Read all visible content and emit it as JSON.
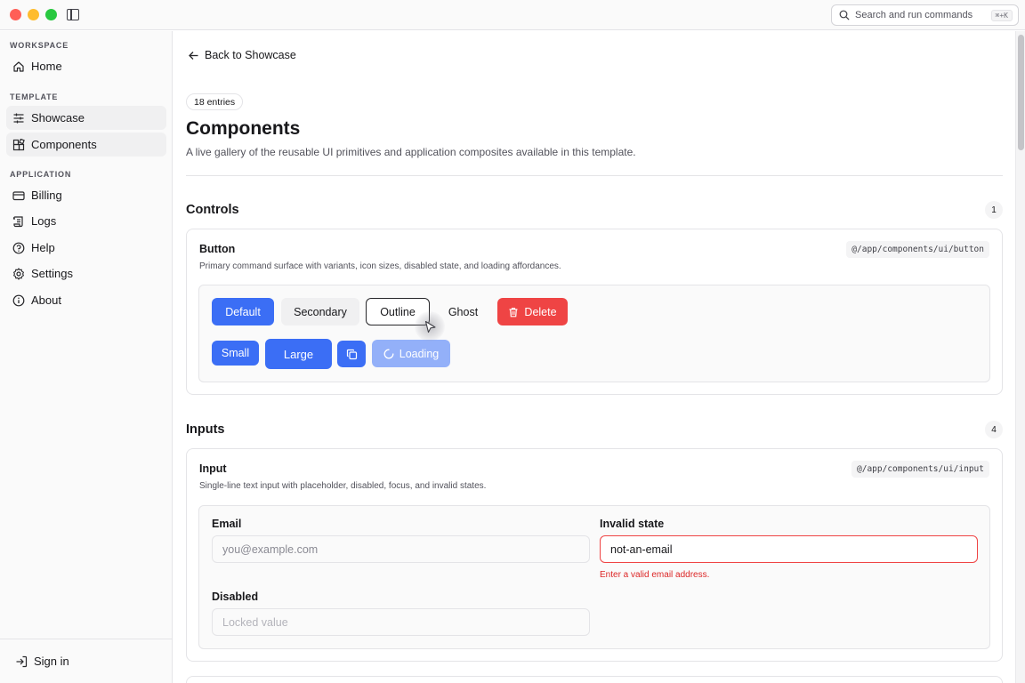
{
  "window": {
    "search": {
      "placeholder": "Search and run commands",
      "shortcut": "⌘+K"
    }
  },
  "sidebar": {
    "groups": [
      {
        "label": "WORKSPACE",
        "items": [
          {
            "label": "Home",
            "icon": "home-icon"
          }
        ]
      },
      {
        "label": "TEMPLATE",
        "items": [
          {
            "label": "Showcase",
            "icon": "sliders-icon"
          },
          {
            "label": "Components",
            "icon": "components-icon"
          }
        ]
      },
      {
        "label": "APPLICATION",
        "items": [
          {
            "label": "Billing",
            "icon": "credit-card-icon"
          },
          {
            "label": "Logs",
            "icon": "scroll-icon"
          },
          {
            "label": "Help",
            "icon": "help-circle-icon"
          },
          {
            "label": "Settings",
            "icon": "gear-icon"
          },
          {
            "label": "About",
            "icon": "info-icon"
          }
        ]
      }
    ],
    "footer": {
      "label": "Sign in",
      "icon": "sign-in-icon"
    }
  },
  "header": {
    "back_label": "Back to Showcase",
    "badge": "18 entries",
    "title": "Components",
    "description": "A live gallery of the reusable UI primitives and application composites available in this template."
  },
  "sections": {
    "controls": {
      "title": "Controls",
      "count": "1",
      "card": {
        "title": "Button",
        "description": "Primary command surface with variants, icon sizes, disabled state, and loading affordances.",
        "path": "@/app/components/ui/button",
        "buttons": {
          "default": "Default",
          "secondary": "Secondary",
          "outline": "Outline",
          "ghost": "Ghost",
          "delete": "Delete",
          "small": "Small",
          "large": "Large",
          "loading": "Loading"
        }
      }
    },
    "inputs": {
      "title": "Inputs",
      "count": "4",
      "card": {
        "title": "Input",
        "description": "Single-line text input with placeholder, disabled, focus, and invalid states.",
        "path": "@/app/components/ui/input",
        "fields": {
          "email": {
            "label": "Email",
            "placeholder": "you@example.com"
          },
          "invalid": {
            "label": "Invalid state",
            "value": "not-an-email",
            "error": "Enter a valid email address."
          },
          "disabled": {
            "label": "Disabled",
            "value": "Locked value"
          }
        }
      }
    }
  },
  "colors": {
    "primary": "#3b6ef5",
    "danger": "#ef4444",
    "loading": "#93b0f9"
  }
}
